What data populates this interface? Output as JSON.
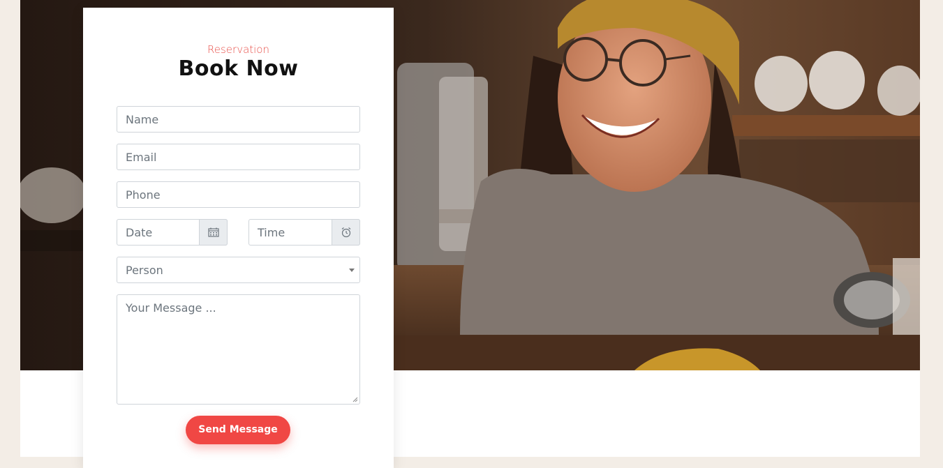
{
  "reservation": {
    "eyebrow": "Reservation",
    "title": "Book Now"
  },
  "form": {
    "name_placeholder": "Name",
    "email_placeholder": "Email",
    "phone_placeholder": "Phone",
    "date_placeholder": "Date",
    "time_placeholder": "Time",
    "person_selected": "Person",
    "message_placeholder": "Your Message ...",
    "submit_label": "Send Message"
  },
  "icons": {
    "date": "calendar-icon",
    "time": "alarm-clock-icon",
    "person": "chevron-down-icon"
  },
  "colors": {
    "accent": "#f04744",
    "eyebrow": "#e8504a",
    "page_background": "#f3ede6"
  }
}
